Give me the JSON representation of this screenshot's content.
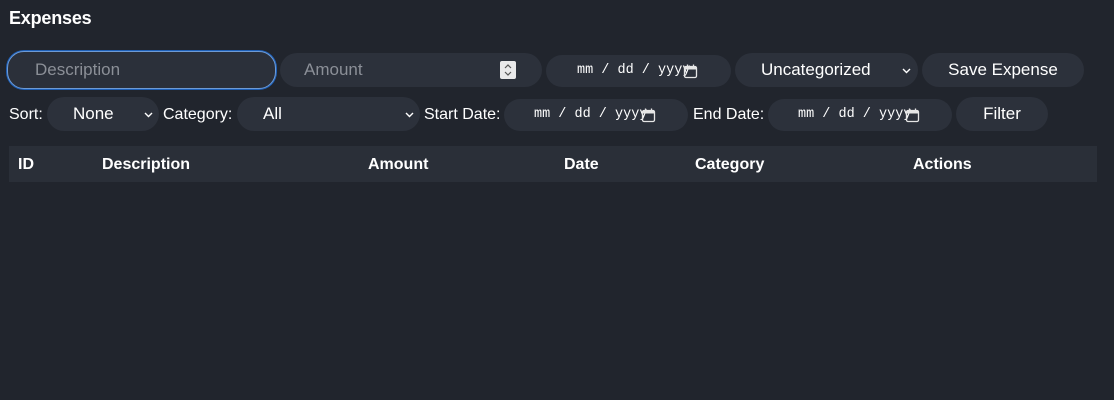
{
  "page": {
    "title": "Expenses"
  },
  "form": {
    "description_placeholder": "Description",
    "amount_placeholder": "Amount",
    "date_placeholder": "mm / dd / yyyy",
    "category_selected": "Uncategorized",
    "save_label": "Save Expense"
  },
  "filters": {
    "sort_label": "Sort:",
    "sort_selected": "None",
    "category_label": "Category:",
    "category_selected": "All",
    "start_label": "Start Date:",
    "start_placeholder": "mm / dd / yyyy",
    "end_label": "End Date:",
    "end_placeholder": "mm / dd / yyyy",
    "filter_label": "Filter"
  },
  "table": {
    "columns": [
      "ID",
      "Description",
      "Amount",
      "Date",
      "Category",
      "Actions"
    ],
    "rows": []
  },
  "colors": {
    "background": "#21252d",
    "control": "#2c313b",
    "focus": "#6e9ad4",
    "header": "#2a2f38"
  }
}
